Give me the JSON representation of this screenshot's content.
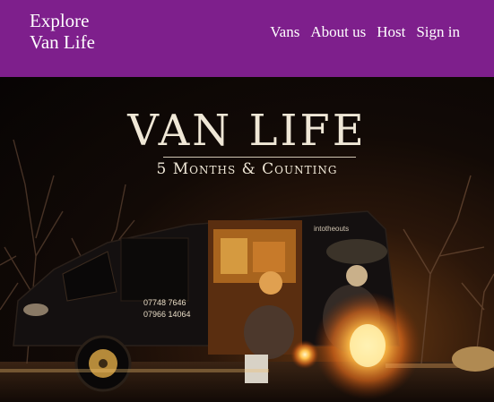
{
  "header": {
    "brand_line1": "Explore",
    "brand_line2": "Van Life",
    "nav": [
      "Vans",
      "About us",
      "Host",
      "Sign in"
    ]
  },
  "hero": {
    "title": "VAN LIFE",
    "subtitle": "5 Months & Counting",
    "van_side_text": "intotheouts",
    "phone_1": "07748 7646",
    "phone_2": "07966 14064"
  },
  "colors": {
    "header_bg": "#7e1f8c",
    "nav_text": "#ffffff",
    "overlay_text": "#efe7d6"
  }
}
